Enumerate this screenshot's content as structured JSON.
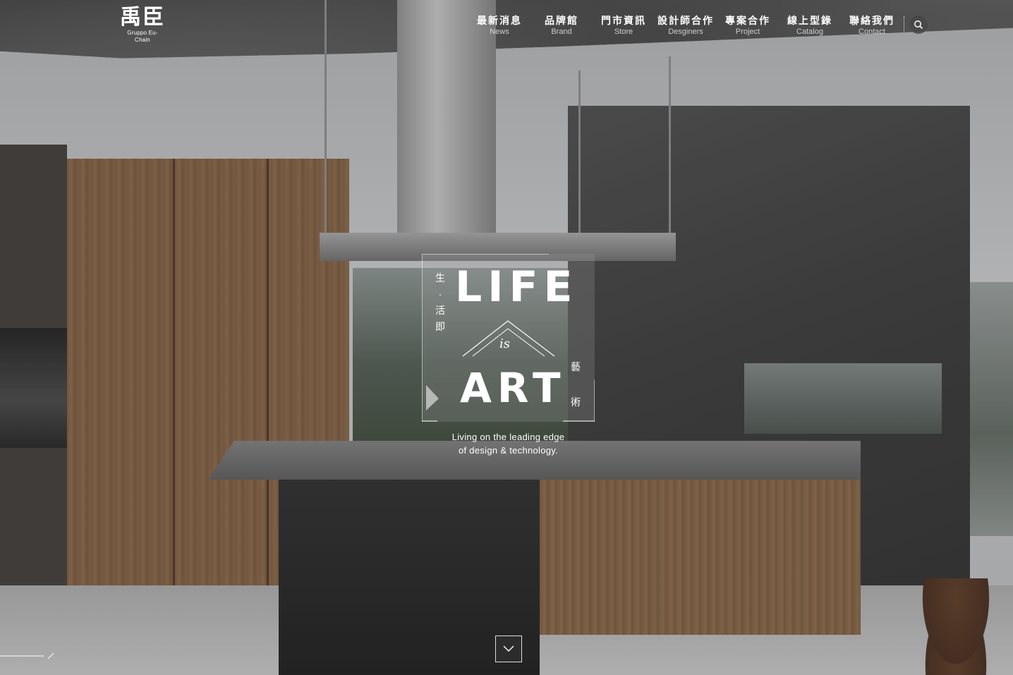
{
  "brand": {
    "logo_text": "禹臣",
    "logo_subtext": "Gruppo Eu-Chain"
  },
  "nav": {
    "items": [
      {
        "zh": "最新消息",
        "en": "News"
      },
      {
        "zh": "品牌館",
        "en": "Brand"
      },
      {
        "zh": "門市資訊",
        "en": "Store"
      },
      {
        "zh": "設計師合作",
        "en": "Desginers"
      },
      {
        "zh": "專案合作",
        "en": "Project"
      },
      {
        "zh": "線上型錄",
        "en": "Catalog"
      },
      {
        "zh": "聯絡我們",
        "en": "Contact"
      }
    ],
    "search_icon": "search-icon"
  },
  "hero": {
    "word_top": "LIFE",
    "word_mid": "is",
    "word_bottom": "ART",
    "vertical_left": [
      "生",
      "·",
      "活",
      "即"
    ],
    "vertical_right": [
      "藝",
      "術"
    ],
    "tagline_line1": "Living on the leading edge",
    "tagline_line2": "of design & technology."
  },
  "controls": {
    "scroll_icon": "chevron-down-icon",
    "slide_indicator_icon": "slide-line-icon"
  },
  "colors": {
    "text": "#ffffff",
    "search_bg": "#464646"
  }
}
